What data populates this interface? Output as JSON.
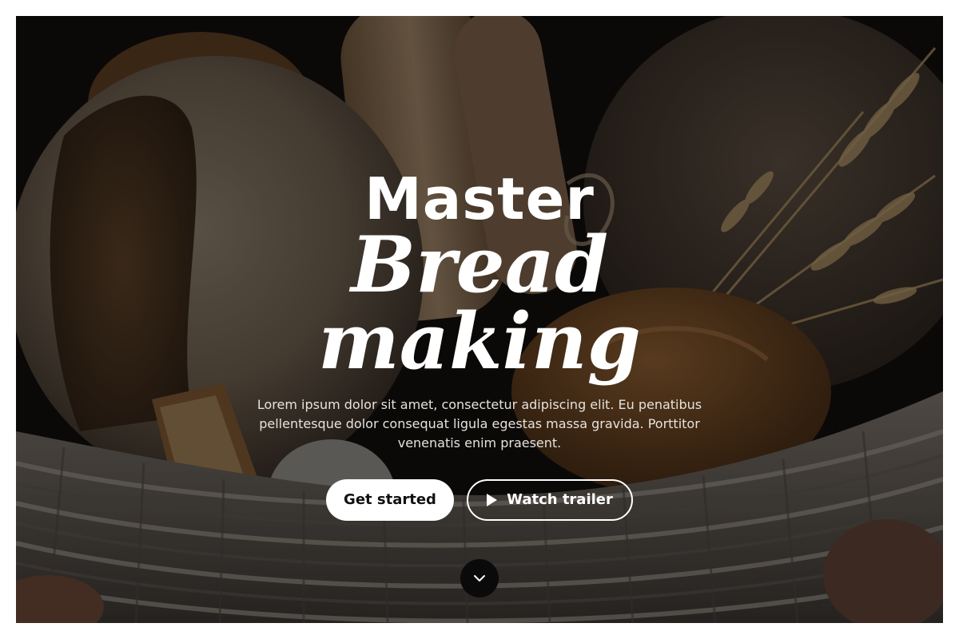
{
  "hero": {
    "title_line1": "Master",
    "title_line2": "Bread",
    "title_line3": "making",
    "subtitle": "Lorem ipsum dolor sit amet, consectetur adipiscing elit. Eu penatibus pellentesque dolor consequat ligula egestas massa gravida. Porttitor venenatis enim praesent.",
    "primary_button_label": "Get started",
    "secondary_button_label": "Watch trailer",
    "secondary_button_icon": "play-icon",
    "scroll_icon": "chevron-down-icon"
  },
  "colors": {
    "primary_button_bg": "#ffffff",
    "primary_button_text": "#111111",
    "scroll_button_bg": "#0a0a0a",
    "text": "#ffffff"
  }
}
